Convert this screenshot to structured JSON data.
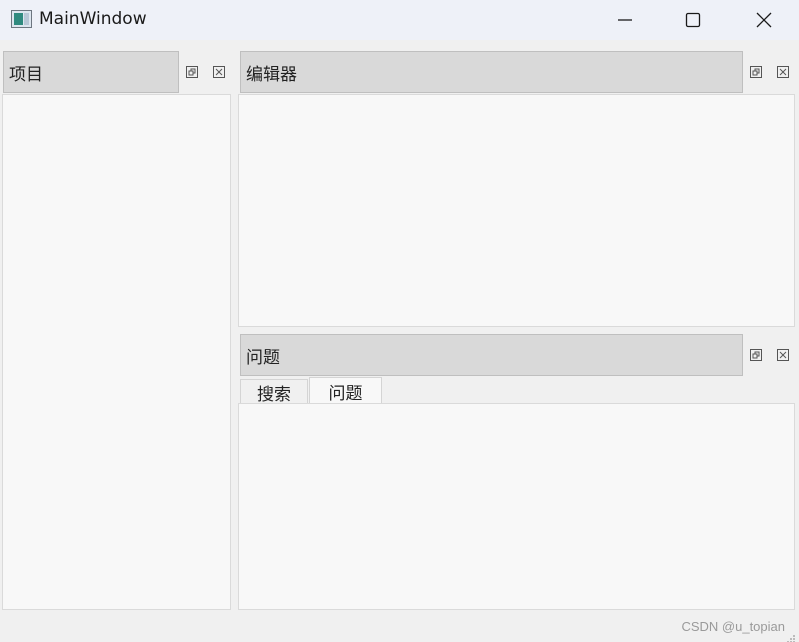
{
  "window": {
    "title": "MainWindow",
    "minimize_icon": "minimize-icon",
    "maximize_icon": "maximize-icon",
    "close_icon": "close-icon"
  },
  "docks": {
    "project": {
      "title": "项目"
    },
    "editor": {
      "title": "编辑器"
    },
    "issues": {
      "title": "问题",
      "tabs": [
        {
          "label": "搜索",
          "active": false
        },
        {
          "label": "问题",
          "active": true
        }
      ]
    }
  },
  "watermark": "CSDN @u_topian"
}
